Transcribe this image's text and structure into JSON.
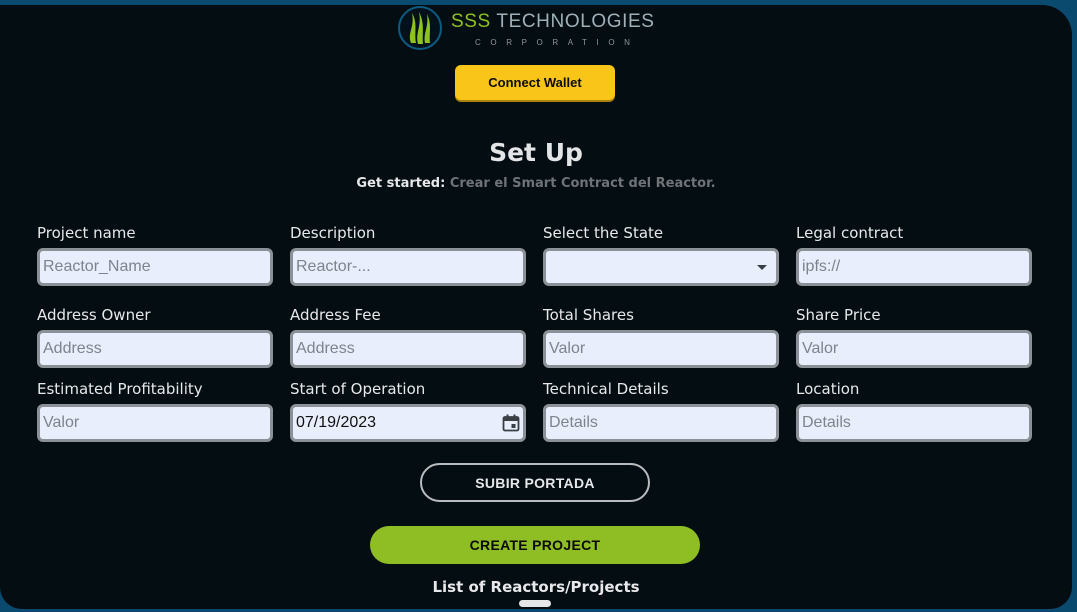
{
  "brand": {
    "name_part1": "SSS",
    "name_part2": "TECHNOLOGIES",
    "subtitle": "CORPORATION",
    "primary_color": "#8ec21f",
    "secondary_color": "#9fb1b8"
  },
  "header": {
    "connect_label": "Connect Wallet",
    "connect_color": "#f9c518"
  },
  "setup": {
    "title": "Set Up",
    "subtitle_strong": "Get started:",
    "subtitle_text": "Crear el Smart Contract del Reactor."
  },
  "form": {
    "project_name": {
      "label": "Project name",
      "placeholder": "Reactor_Name"
    },
    "description": {
      "label": "Description",
      "placeholder": "Reactor-..."
    },
    "state": {
      "label": "Select the State",
      "value": ""
    },
    "legal_contract": {
      "label": "Legal contract",
      "placeholder": "ipfs://"
    },
    "address_owner": {
      "label": "Address Owner",
      "placeholder": "Address"
    },
    "address_fee": {
      "label": "Address Fee",
      "placeholder": "Address"
    },
    "total_shares": {
      "label": "Total Shares",
      "placeholder": "Valor"
    },
    "share_price": {
      "label": "Share Price",
      "placeholder": "Valor"
    },
    "estimated_profitability": {
      "label": "Estimated Profitability",
      "placeholder": "Valor"
    },
    "start_of_operation": {
      "label": "Start of Operation",
      "value": "07/19/2023"
    },
    "technical_details": {
      "label": "Technical Details",
      "placeholder": "Details"
    },
    "location": {
      "label": "Location",
      "placeholder": "Details"
    }
  },
  "actions": {
    "upload_label": "SUBIR PORTADA",
    "create_label": "CREATE PROJECT",
    "create_color": "#8fbe24"
  },
  "list": {
    "title": "List of Reactors/Projects"
  },
  "icons": {
    "logo": "flame-logo-icon",
    "select": "chevron-down-icon",
    "date": "calendar-icon"
  }
}
